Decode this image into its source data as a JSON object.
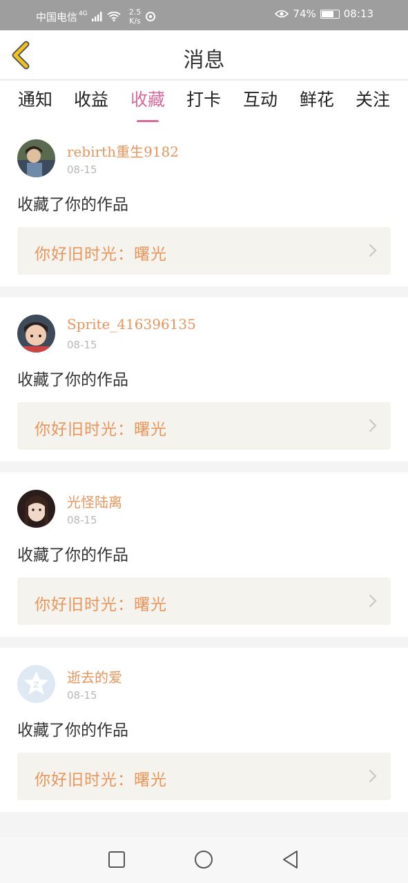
{
  "status": {
    "carrier": "中国电信",
    "network": "4G",
    "speed_value": "2.5",
    "speed_unit": "K/s",
    "battery": "74%",
    "time": "08:13",
    "battery_level": 0.74
  },
  "header": {
    "title": "消息",
    "back_icon": "chevron-left-icon"
  },
  "tabs": [
    {
      "label": "通知"
    },
    {
      "label": "收益"
    },
    {
      "label": "收藏"
    },
    {
      "label": "打卡"
    },
    {
      "label": "互动"
    },
    {
      "label": "鲜花"
    },
    {
      "label": "关注"
    }
  ],
  "active_tab": "收藏",
  "notifications": [
    {
      "user": "rebirth重生9182",
      "date": "08-15",
      "action": "收藏了你的作品",
      "work_title": "你好旧时光：曙光"
    },
    {
      "user": "Sprite_416396135",
      "date": "08-15",
      "action": "收藏了你的作品",
      "work_title": "你好旧时光：曙光"
    },
    {
      "user": "光怪陆离",
      "date": "08-15",
      "action": "收藏了你的作品",
      "work_title": "你好旧时光：曙光"
    },
    {
      "user": "逝去的爱",
      "date": "08-15",
      "action": "收藏了你的作品",
      "work_title": "你好旧时光：曙光"
    }
  ],
  "colors": {
    "accent": "#d86a9b",
    "username": "#e8955c",
    "back_arrow": "#f0c419"
  },
  "navbar": {
    "icons": [
      "square-icon",
      "circle-icon",
      "triangle-back-icon"
    ]
  }
}
